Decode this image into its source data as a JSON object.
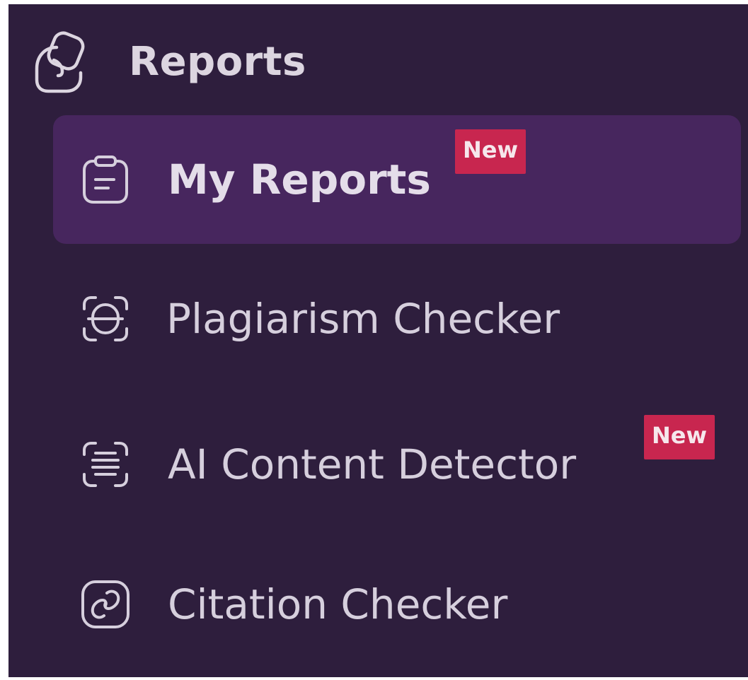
{
  "section": {
    "title": "Reports",
    "icon": "reports-stack-icon"
  },
  "nav": {
    "items": [
      {
        "label": "My Reports",
        "icon": "clipboard-icon",
        "badge": "New",
        "active": true
      },
      {
        "label": "Plagiarism Checker",
        "icon": "plagiarism-scan-icon",
        "badge": "",
        "active": false
      },
      {
        "label": "AI Content Detector",
        "icon": "ai-scan-lines-icon",
        "badge": "New",
        "active": false
      },
      {
        "label": "Citation Checker",
        "icon": "citation-link-icon",
        "badge": "",
        "active": false
      }
    ]
  },
  "colors": {
    "panel_bg": "#2e1e3d",
    "active_bg": "#47265e",
    "text": "#d6cfdd",
    "badge_bg": "#c8264f"
  }
}
